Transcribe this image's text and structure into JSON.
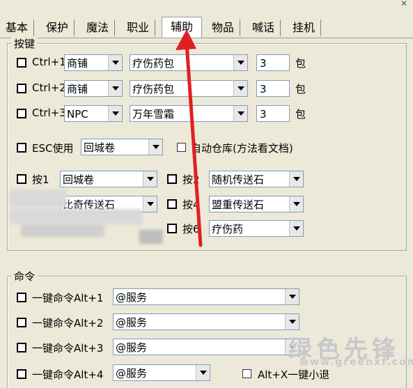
{
  "tabs": [
    {
      "label": "基本"
    },
    {
      "label": "保护"
    },
    {
      "label": "魔法"
    },
    {
      "label": "职业"
    },
    {
      "label": "辅助",
      "active": true
    },
    {
      "label": "物品"
    },
    {
      "label": "喊话"
    },
    {
      "label": "挂机"
    }
  ],
  "hotkeys": {
    "legend": "按键",
    "rows": [
      {
        "key": "Ctrl+1",
        "type": "商铺",
        "item": "疗伤药包",
        "qty": "3",
        "unit": "包"
      },
      {
        "key": "Ctrl+2",
        "type": "商铺",
        "item": "疗伤药包",
        "qty": "3",
        "unit": "包"
      },
      {
        "key": "Ctrl+3",
        "type": "NPC",
        "item": "万年雪霜",
        "qty": "3",
        "unit": "包"
      }
    ],
    "esc": {
      "label": "ESC使用",
      "value": "回城卷"
    },
    "auto_store": {
      "label": "自动仓库(方法看文档)"
    },
    "press": [
      {
        "label": "按1",
        "value": "回城卷"
      },
      {
        "label": "按2",
        "value": "随机传送石"
      },
      {
        "label": "按4",
        "value": "盟重传送石"
      },
      {
        "label": "按6",
        "value": "疗伤药"
      }
    ],
    "obscured_value": "比奇传送石"
  },
  "commands": {
    "legend": "命令",
    "rows": [
      {
        "label": "一键命令Alt+1",
        "value": "@服务"
      },
      {
        "label": "一键命令Alt+2",
        "value": "@服务"
      },
      {
        "label": "一键命令Alt+3",
        "value": "@服务"
      },
      {
        "label": "一键命令Alt+4",
        "value": "@服务"
      }
    ],
    "alt_x": {
      "label": "Alt+X一键小退"
    }
  },
  "watermark": {
    "brand": "绿色先锋",
    "url": "www.greenxf.com"
  },
  "colors": {
    "arrow": "#e02020",
    "bg": "#ece9d8"
  }
}
